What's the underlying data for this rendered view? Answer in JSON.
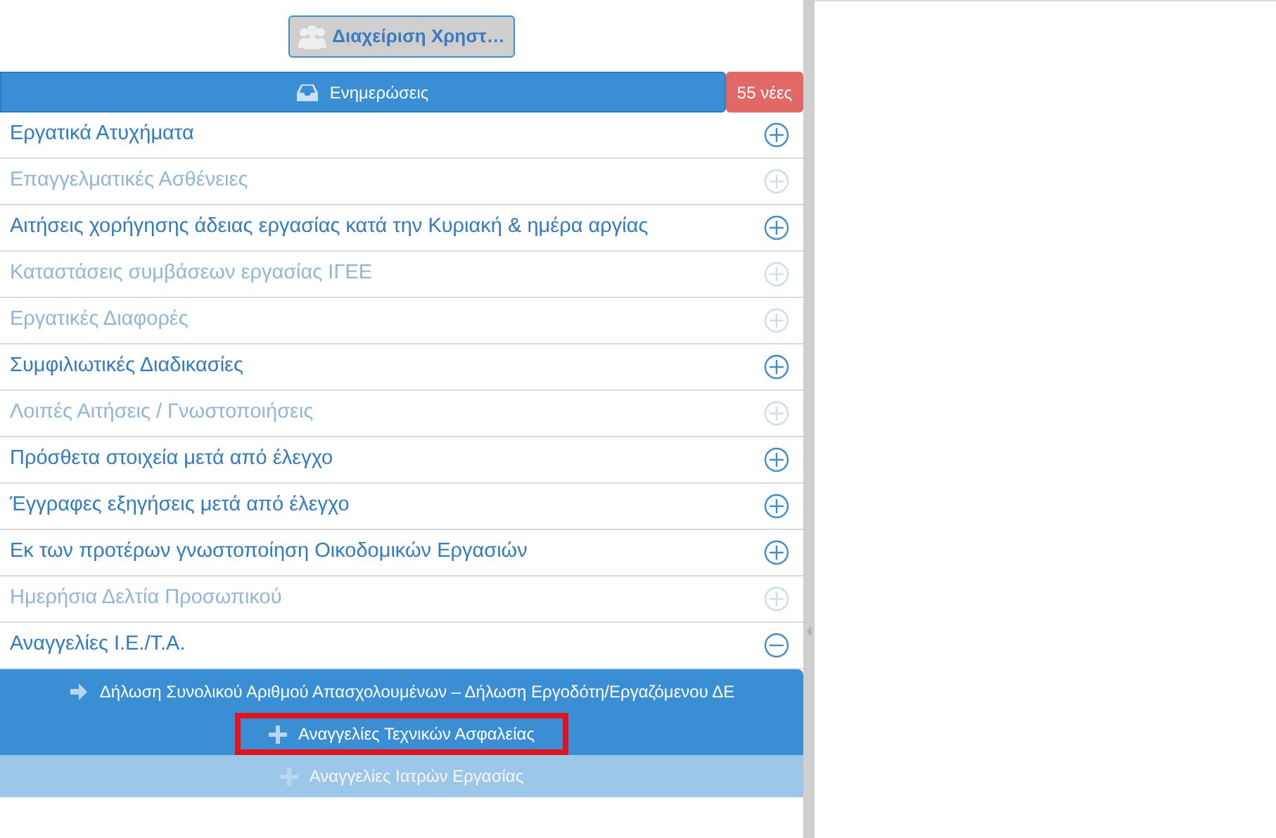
{
  "user_button": {
    "label": "Διαχείριση Χρηστ…"
  },
  "updates": {
    "label": "Ενημερώσεις",
    "badge": "55 νέες"
  },
  "menu": [
    {
      "label": "Εργατικά Ατυχήματα",
      "disabled": false,
      "expanded": false
    },
    {
      "label": "Επαγγελματικές Ασθένειες",
      "disabled": true,
      "expanded": false
    },
    {
      "label": "Αιτήσεις χορήγησης άδειας εργασίας κατά την Κυριακή & ημέρα αργίας",
      "disabled": false,
      "expanded": false
    },
    {
      "label": "Καταστάσεις συμβάσεων εργασίας ΙΓΕΕ",
      "disabled": true,
      "expanded": false
    },
    {
      "label": "Εργατικές Διαφορές",
      "disabled": true,
      "expanded": false
    },
    {
      "label": "Συμφιλιωτικές Διαδικασίες",
      "disabled": false,
      "expanded": false
    },
    {
      "label": "Λοιπές Αιτήσεις / Γνωστοποιήσεις",
      "disabled": true,
      "expanded": false
    },
    {
      "label": "Πρόσθετα στοιχεία μετά από έλεγχο",
      "disabled": false,
      "expanded": false
    },
    {
      "label": "Έγγραφες εξηγήσεις μετά από έλεγχο",
      "disabled": false,
      "expanded": false
    },
    {
      "label": "Εκ των προτέρων γνωστοποίηση Οικοδομικών Εργασιών",
      "disabled": false,
      "expanded": false
    },
    {
      "label": "Ημερήσια Δελτία Προσωπικού",
      "disabled": true,
      "expanded": false
    },
    {
      "label": "Αναγγελίες Ι.Ε./Τ.Α.",
      "disabled": false,
      "expanded": true,
      "children": [
        {
          "label": "Δήλωση Συνολικού Αριθμού Απασχολουμένων – Δήλωση Εργοδότη/Εργαζόμενου ΔΕ",
          "kind": "arrow",
          "disabled": false,
          "highlighted": false
        },
        {
          "label": "Αναγγελίες Τεχνικών Ασφαλείας",
          "kind": "plus",
          "disabled": false,
          "highlighted": true
        },
        {
          "label": "Αναγγελίες Ιατρών Εργασίας",
          "kind": "plus",
          "disabled": true,
          "highlighted": false
        }
      ]
    }
  ]
}
